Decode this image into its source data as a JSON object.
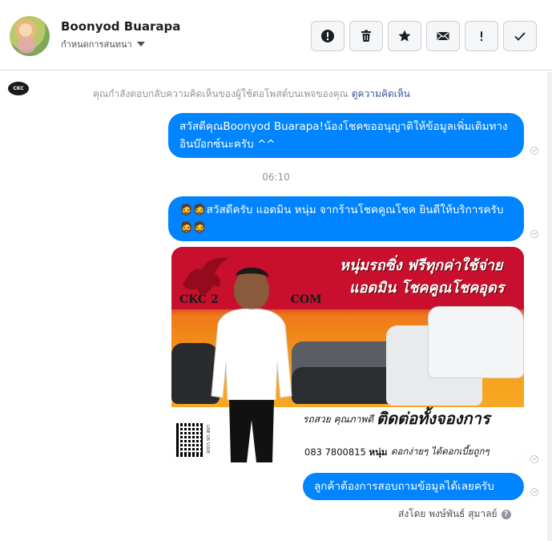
{
  "header": {
    "name": "Boonyod Buarapa",
    "assign_label": "กำหนดการสนทนา",
    "tools": [
      {
        "id": "spam",
        "icon": "exclamation-circle-icon"
      },
      {
        "id": "delete",
        "icon": "trash-icon"
      },
      {
        "id": "star",
        "icon": "star-icon"
      },
      {
        "id": "unread",
        "icon": "envelope-icon"
      },
      {
        "id": "follow-up",
        "icon": "exclamation-icon"
      },
      {
        "id": "done",
        "icon": "checkmark-icon"
      }
    ]
  },
  "thread": {
    "notice_text": "คุณกำลังตอบกลับความคิดเห็นของผู้ใช้ต่อโพสต์บนเพจของคุณ",
    "notice_link": "ดูความคิดเห็น",
    "page_icon_label": "CKC",
    "messages": [
      {
        "text": "สวัสดีคุณBoonyod Buarapa!น้องโชคขออนุญาติให้ข้อมูลเพิ่มเติมทางอินบ๊อกซ์นะครับ ^^"
      },
      {
        "text": "🧔🧔สวัสดีครับ แอดมิน หนุ่ม จากร้านโชคคูณโชค ยินดีให้บริการครับ🧔🧔"
      },
      {
        "text": "ลูกค้าต้องการสอบถามข้อมูลได้เลยครับ"
      }
    ],
    "timestamp": "06:10",
    "sent_by": "ส่งโดย พงษ์พันธ์ สุมาลย์",
    "sent_by_help": "?"
  },
  "image": {
    "logo_text": "CKC 2",
    "logo_text_tail": "COM",
    "headline_1": "หนุ่มรถซิ่ง ฟรีทุกค่าใช้จ่าย",
    "headline_2": "แอดมิน โชคคูณโชคอุดร",
    "brand": "รถสวย คุณภาพดี",
    "contact": "ติดต่อทั้งจองการ",
    "phone": "083 7800815",
    "phone_name": "หนุ่ม",
    "slogan": "ดอกง่ายๆ ได้ดอกเบี้ยถูกๆ",
    "qr_label": "LINE QR CODE"
  },
  "colors": {
    "bubble": "#0084ff",
    "link": "#385898",
    "muted": "#90949c"
  }
}
